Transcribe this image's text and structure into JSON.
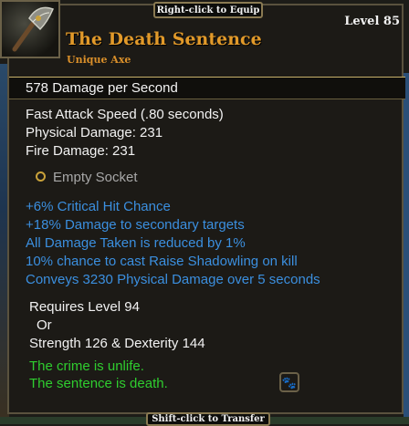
{
  "hints": {
    "equip": "Right-click to Equip",
    "transfer": "Shift-click to Transfer"
  },
  "item": {
    "level": "Level 85",
    "name": "The Death Sentence",
    "type": "Unique Axe",
    "icon": "axe-icon",
    "dps": "578  Damage per Second",
    "base_stats": [
      "Fast Attack Speed (.80 seconds)",
      "Physical Damage: 231",
      "Fire Damage: 231"
    ],
    "socket": "Empty Socket",
    "modifiers": [
      "+6% Critical Hit Chance",
      "+18% Damage to secondary targets",
      "All Damage Taken is reduced by 1%",
      "10% chance to cast Raise Shadowling on kill",
      "Conveys 3230 Physical Damage over 5 seconds"
    ],
    "requirements": [
      "Requires Level 94",
      "Or",
      "Strength 126 & Dexterity 144"
    ],
    "flavor": [
      "The crime is unlife.",
      "The sentence is death."
    ]
  },
  "colors": {
    "name": "#e29a2a",
    "modifier": "#3b8fdf",
    "flavor": "#2fcd2f",
    "border": "#5a523e"
  }
}
